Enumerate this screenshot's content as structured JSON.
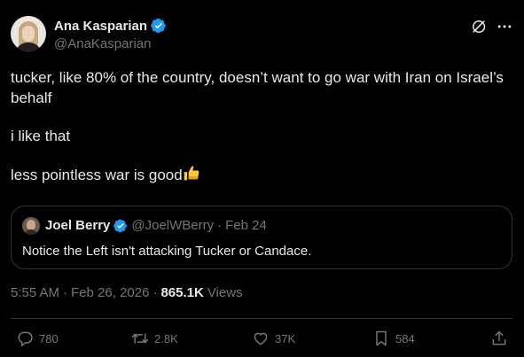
{
  "author": {
    "display_name": "Ana Kasparian",
    "handle": "@AnaKasparian",
    "verified": true
  },
  "tweet": {
    "lines": [
      "tucker, like 80% of the country, doesn’t want to go war with Iran on Israel’s behalf",
      "i like that",
      "less pointless war is good"
    ],
    "emoji": "thumbs-up"
  },
  "quote": {
    "display_name": "Joel Berry",
    "handle": "@JoelWBerry",
    "separator": "·",
    "date": "Feb 24",
    "text": "Notice the Left isn't attacking Tucker or Candace."
  },
  "meta": {
    "time": "5:55 AM",
    "separator": "·",
    "date": "Feb 26, 2026",
    "separator2": "·",
    "views_count": "865.1K",
    "views_label": "Views"
  },
  "actions": {
    "replies": "780",
    "reposts": "2.8K",
    "likes": "37K",
    "bookmarks": "584"
  },
  "icons": {
    "verified": "verified-badge-icon",
    "grok": "grok-icon",
    "more": "more-icon",
    "reply": "reply-icon",
    "repost": "repost-icon",
    "like": "heart-icon",
    "bookmark": "bookmark-icon",
    "share": "share-icon"
  },
  "colors": {
    "background": "#000000",
    "text": "#e7e9ea",
    "secondary": "#71767b",
    "border": "#2f3336",
    "verified": "#1d9bf0",
    "emoji": "#ffc83d"
  }
}
